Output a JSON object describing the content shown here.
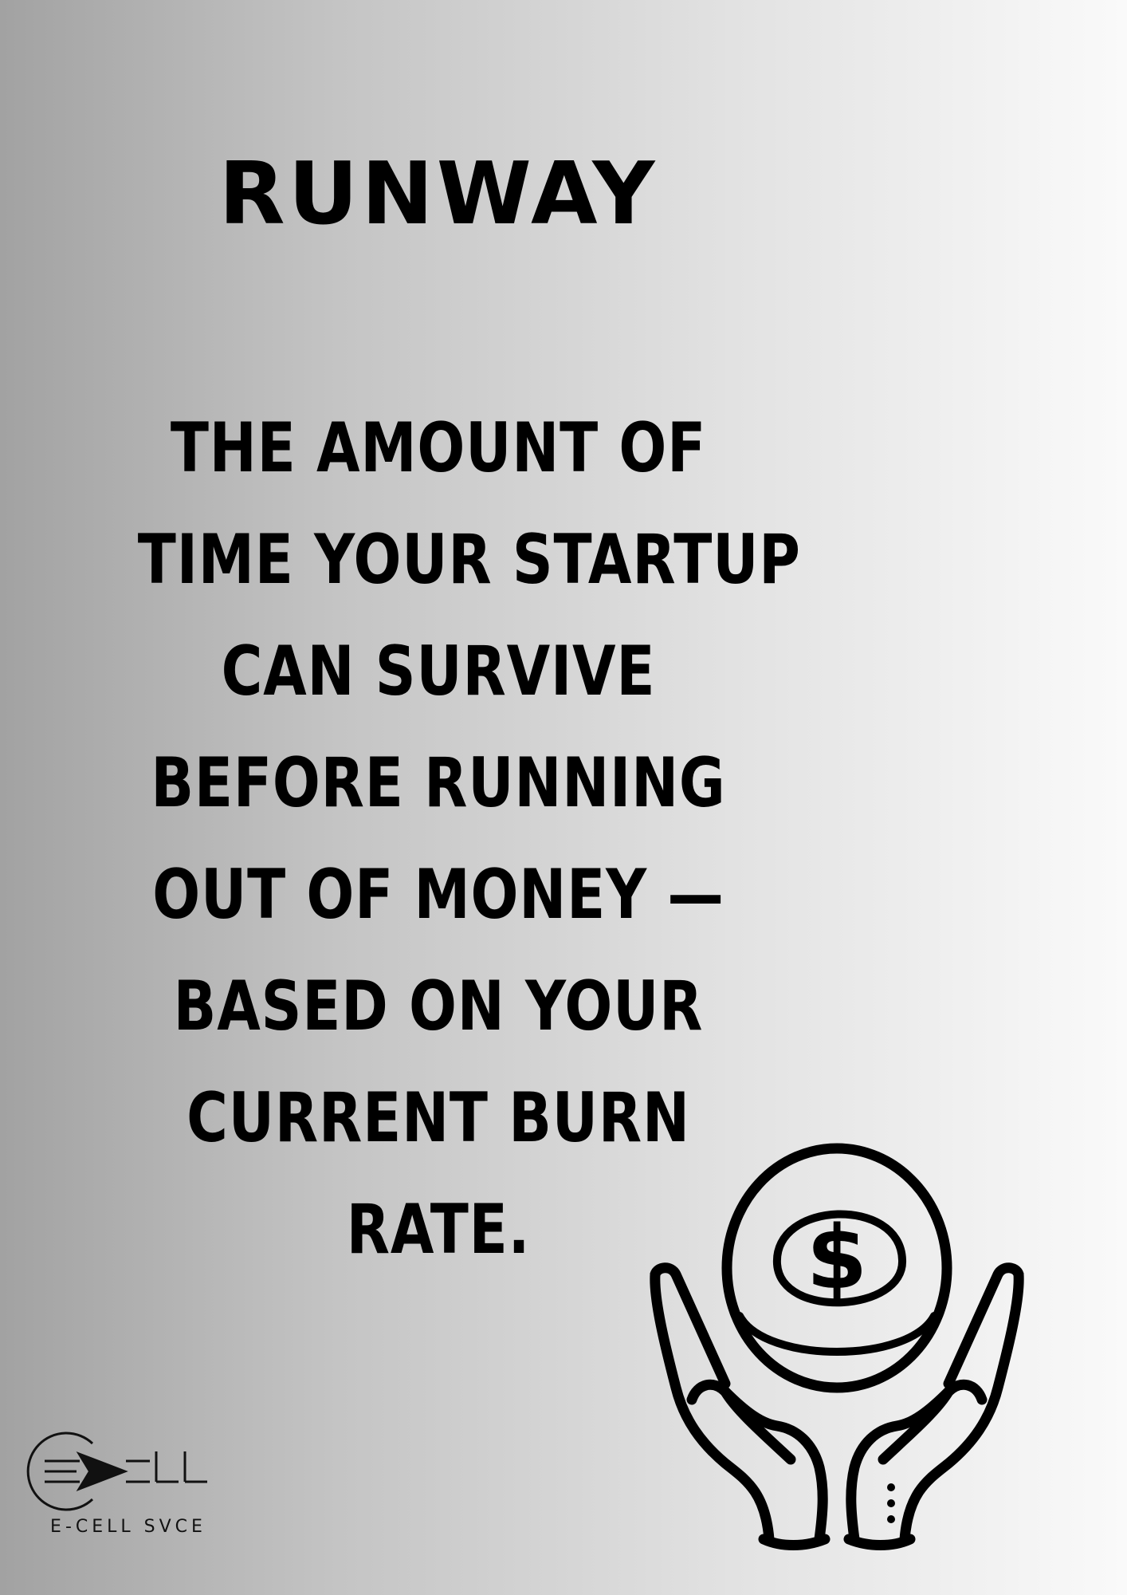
{
  "title": "RUNWAY",
  "definition": {
    "lines": [
      "THE AMOUNT OF",
      "TIME YOUR STARTUP",
      "CAN SURVIVE",
      "BEFORE RUNNING",
      "OUT OF MONEY —",
      "BASED ON YOUR",
      "CURRENT BURN",
      "RATE."
    ]
  },
  "icon": {
    "name": "hands-holding-dollar-coin-icon",
    "symbol": "$"
  },
  "logo": {
    "name": "e-cell-logo",
    "wordmark": "E≡CELL",
    "caption": "E-CELL SVCE"
  },
  "colors": {
    "text": "#000000",
    "background_left": "#a2a2a2",
    "background_right": "#fafafa"
  }
}
